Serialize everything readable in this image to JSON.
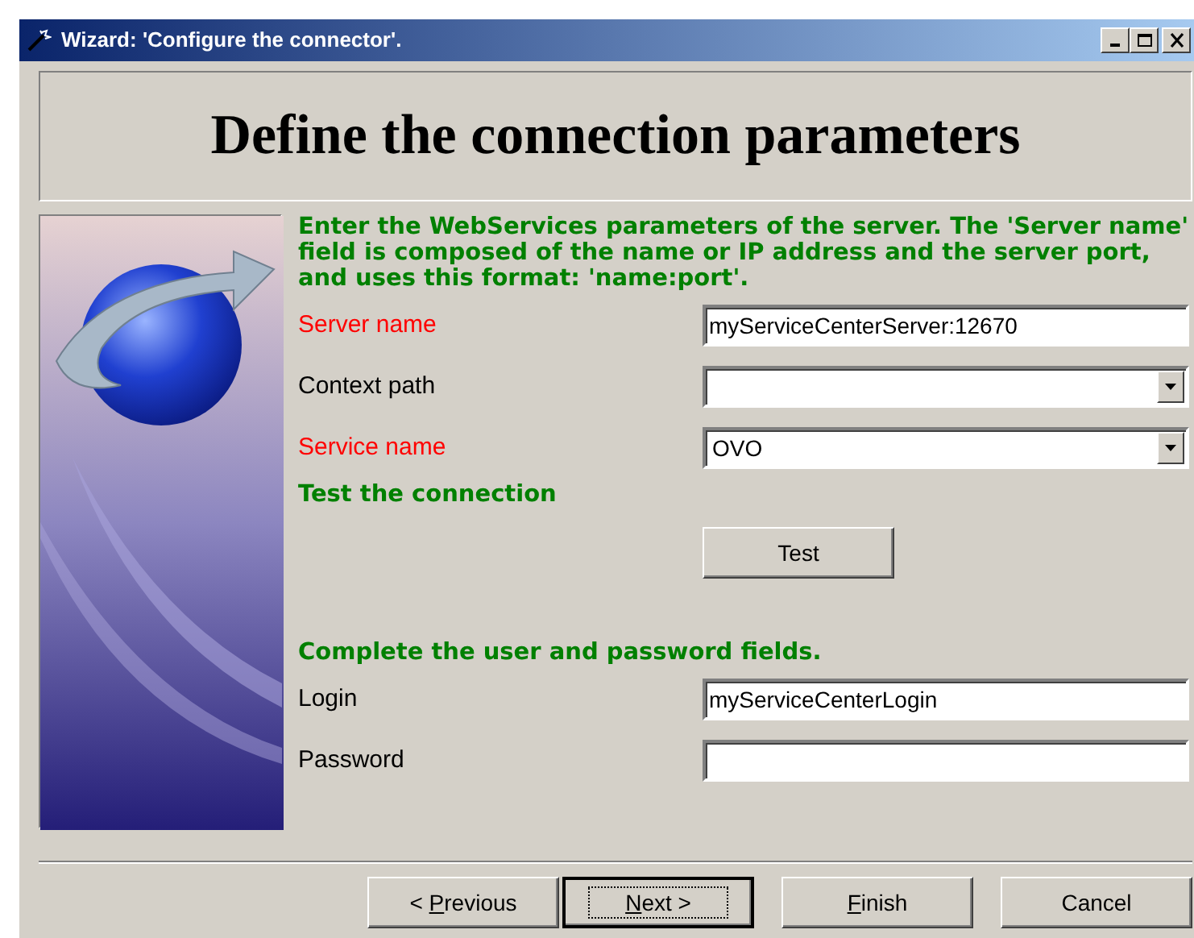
{
  "window": {
    "title": "Wizard: 'Configure the connector'."
  },
  "header": {
    "title": "Define the connection parameters"
  },
  "sections": [
    {
      "kind": "fields",
      "intro": "Enter the WebServices parameters of the server. The 'Server name' field is composed of the name or IP address and the server port, and uses this format: 'name:port'.",
      "fields": [
        {
          "label": "Server name",
          "required": true,
          "kind": "text",
          "value": "myServiceCenterServer:12670"
        },
        {
          "label": "Context path",
          "required": false,
          "kind": "combo"
        },
        {
          "label": "Service name",
          "required": true,
          "kind": "combo",
          "value": "OVO"
        }
      ]
    },
    {
      "kind": "test",
      "intro": "Test the connection",
      "button": "Test"
    },
    {
      "kind": "fields",
      "intro": "Complete the user and password fields.",
      "fields": [
        {
          "label": "Login",
          "required": false,
          "kind": "text",
          "value": "myServiceCenterLogin"
        },
        {
          "label": "Password",
          "required": false,
          "kind": "text"
        }
      ]
    }
  ],
  "buttons": [
    {
      "before": "< ",
      "access_key": "P",
      "after": "revious",
      "default": false
    },
    {
      "access_key": "N",
      "after": "ext >",
      "default": true
    },
    {
      "access_key": "F",
      "after": "inish",
      "default": false
    },
    {
      "after": "Cancel",
      "default": false
    }
  ]
}
